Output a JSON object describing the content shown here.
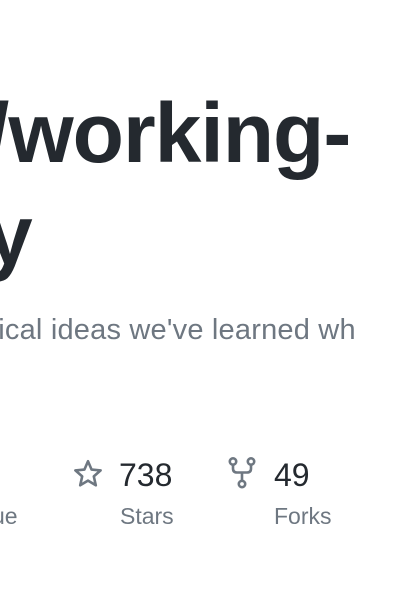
{
  "header": {
    "title_line1": "/working-",
    "title_line2": "y",
    "description": "tical ideas we've learned wh"
  },
  "stats": {
    "issues": {
      "label": "ue"
    },
    "stars": {
      "value": "738",
      "label": "Stars",
      "icon": "star-icon"
    },
    "forks": {
      "value": "49",
      "label": "Forks",
      "icon": "fork-icon"
    }
  },
  "colors": {
    "title": "#24292f",
    "muted": "#6e7781",
    "icon": "#6e7781"
  }
}
